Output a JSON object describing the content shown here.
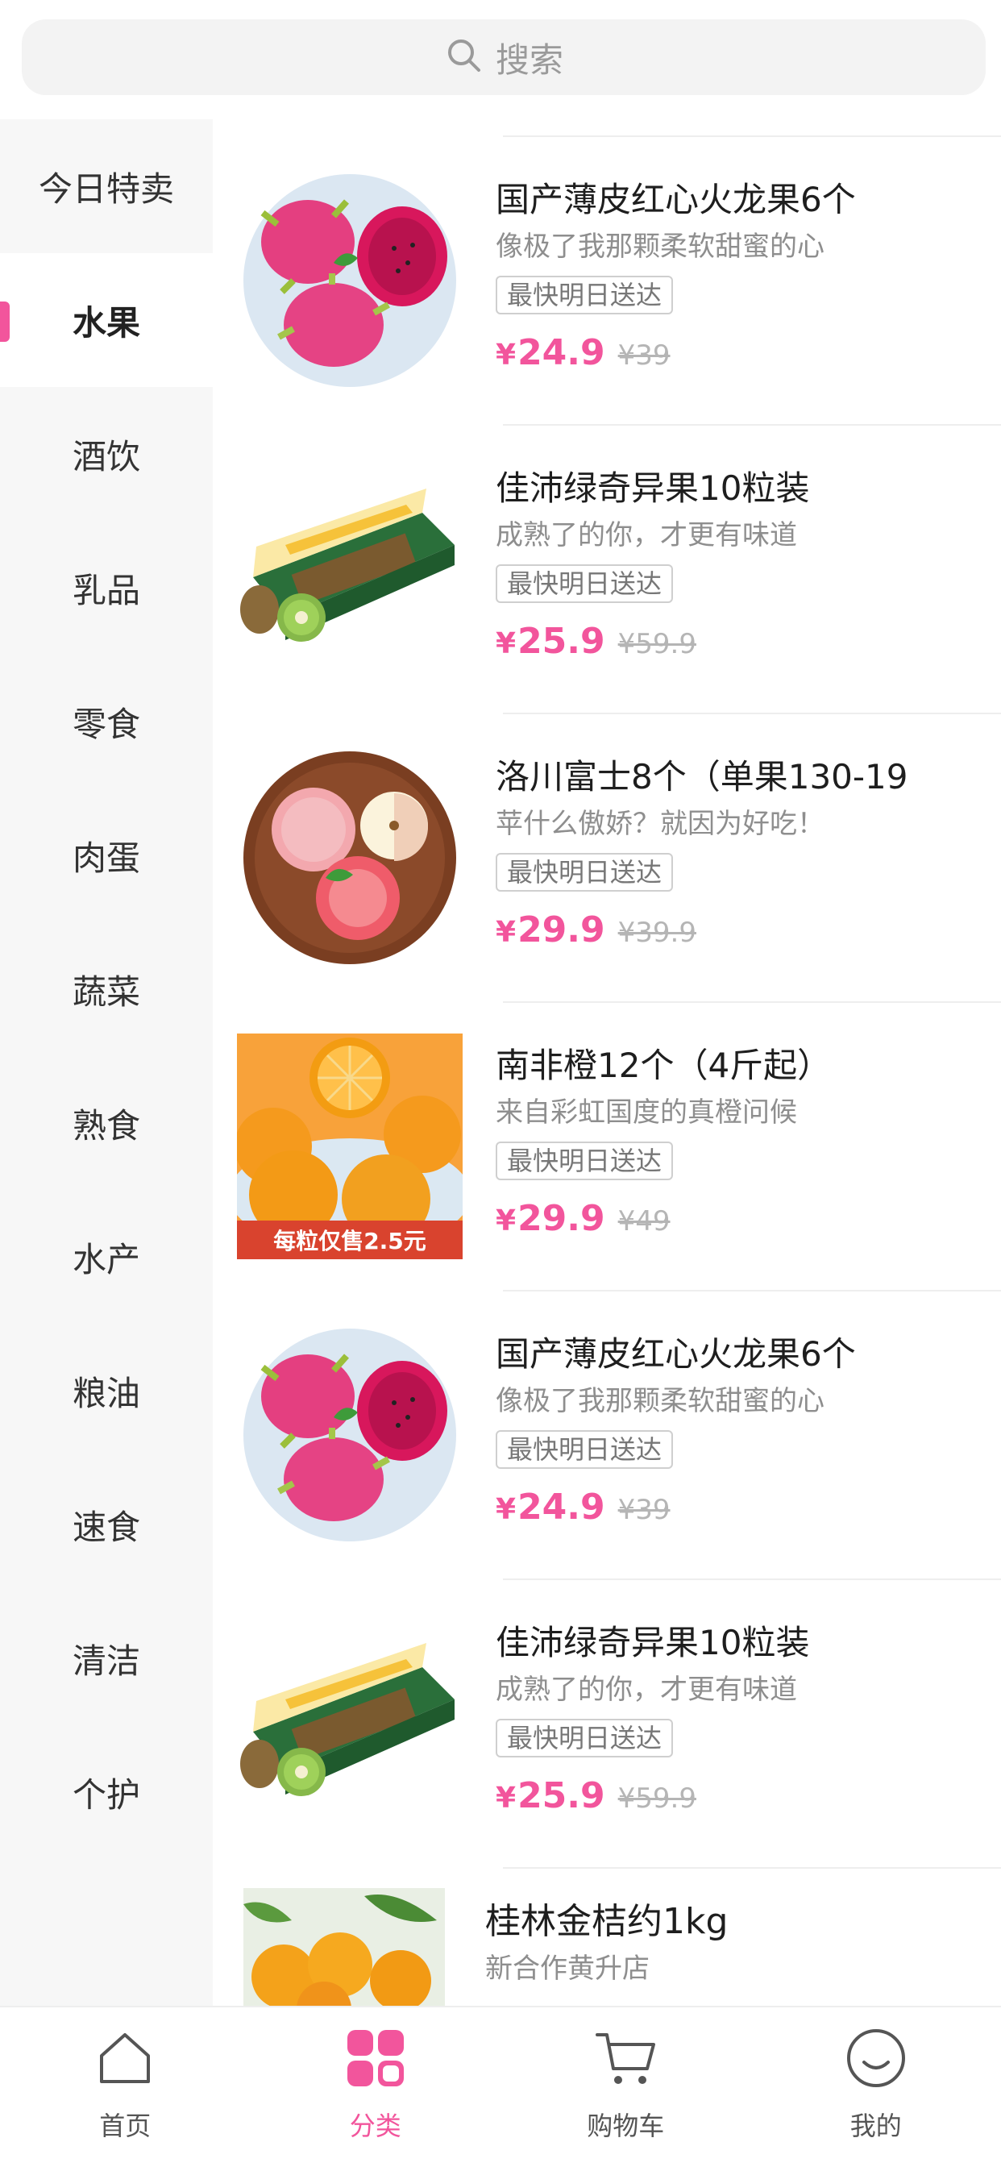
{
  "search": {
    "placeholder": "搜索",
    "icon": "search-icon"
  },
  "sidebar": {
    "active_index": 1,
    "items": [
      {
        "label": "今日特卖"
      },
      {
        "label": "水果"
      },
      {
        "label": "酒饮"
      },
      {
        "label": "乳品"
      },
      {
        "label": "零食"
      },
      {
        "label": "肉蛋"
      },
      {
        "label": "蔬菜"
      },
      {
        "label": "熟食"
      },
      {
        "label": "水产"
      },
      {
        "label": "粮油"
      },
      {
        "label": "速食"
      },
      {
        "label": "清洁"
      },
      {
        "label": "个护"
      }
    ]
  },
  "products": [
    {
      "title": "国产薄皮红心火龙果6个",
      "subtitle": "像极了我那颗柔软甜蜜的心",
      "tag": "最快明日送达",
      "currency": "¥",
      "price": "24.9",
      "old_price": "¥39",
      "image": "dragon-fruit-image"
    },
    {
      "title": "佳沛绿奇异果10粒装",
      "subtitle": "成熟了的你，才更有味道",
      "tag": "最快明日送达",
      "currency": "¥",
      "price": "25.9",
      "old_price": "¥59.9",
      "image": "kiwi-box-image"
    },
    {
      "title": "洛川富士8个（单果130-19",
      "subtitle": "苹什么傲娇？就因为好吃！",
      "tag": "最快明日送达",
      "currency": "¥",
      "price": "29.9",
      "old_price": "¥39.9",
      "image": "apple-plate-image"
    },
    {
      "title": "南非橙12个（4斤起）",
      "subtitle": "来自彩虹国度的真橙问候",
      "tag": "最快明日送达",
      "currency": "¥",
      "price": "29.9",
      "old_price": "¥49",
      "image": "orange-image",
      "image_caption": "每粒仅售2.5元"
    },
    {
      "title": "国产薄皮红心火龙果6个",
      "subtitle": "像极了我那颗柔软甜蜜的心",
      "tag": "最快明日送达",
      "currency": "¥",
      "price": "24.9",
      "old_price": "¥39",
      "image": "dragon-fruit-image"
    },
    {
      "title": "佳沛绿奇异果10粒装",
      "subtitle": "成熟了的你，才更有味道",
      "tag": "最快明日送达",
      "currency": "¥",
      "price": "25.9",
      "old_price": "¥59.9",
      "image": "kiwi-box-image"
    }
  ],
  "partial_product": {
    "title": "桂林金桔约1kg",
    "subtitle": "新合作黄升店",
    "image": "kumquat-image"
  },
  "tabbar": {
    "active_index": 1,
    "items": [
      {
        "label": "首页",
        "icon": "home-icon"
      },
      {
        "label": "分类",
        "icon": "category-icon"
      },
      {
        "label": "购物车",
        "icon": "cart-icon"
      },
      {
        "label": "我的",
        "icon": "profile-icon"
      }
    ]
  },
  "colors": {
    "accent": "#f2559c",
    "text": "#1e1e1e",
    "muted": "#8e8e8e",
    "sidebar_bg": "#f7f7f7"
  }
}
